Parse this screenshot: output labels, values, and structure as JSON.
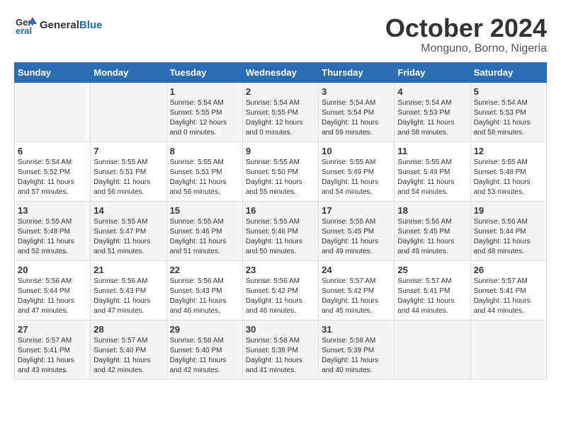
{
  "header": {
    "logo_general": "General",
    "logo_blue": "Blue",
    "title": "October 2024",
    "subtitle": "Monguno, Borno, Nigeria"
  },
  "columns": [
    "Sunday",
    "Monday",
    "Tuesday",
    "Wednesday",
    "Thursday",
    "Friday",
    "Saturday"
  ],
  "weeks": [
    [
      {
        "day": "",
        "info": ""
      },
      {
        "day": "",
        "info": ""
      },
      {
        "day": "1",
        "info": "Sunrise: 5:54 AM\nSunset: 5:55 PM\nDaylight: 12 hours\nand 0 minutes."
      },
      {
        "day": "2",
        "info": "Sunrise: 5:54 AM\nSunset: 5:55 PM\nDaylight: 12 hours\nand 0 minutes."
      },
      {
        "day": "3",
        "info": "Sunrise: 5:54 AM\nSunset: 5:54 PM\nDaylight: 11 hours\nand 59 minutes."
      },
      {
        "day": "4",
        "info": "Sunrise: 5:54 AM\nSunset: 5:53 PM\nDaylight: 11 hours\nand 58 minutes."
      },
      {
        "day": "5",
        "info": "Sunrise: 5:54 AM\nSunset: 5:53 PM\nDaylight: 11 hours\nand 58 minutes."
      }
    ],
    [
      {
        "day": "6",
        "info": "Sunrise: 5:54 AM\nSunset: 5:52 PM\nDaylight: 11 hours\nand 57 minutes."
      },
      {
        "day": "7",
        "info": "Sunrise: 5:55 AM\nSunset: 5:51 PM\nDaylight: 11 hours\nand 56 minutes."
      },
      {
        "day": "8",
        "info": "Sunrise: 5:55 AM\nSunset: 5:51 PM\nDaylight: 11 hours\nand 56 minutes."
      },
      {
        "day": "9",
        "info": "Sunrise: 5:55 AM\nSunset: 5:50 PM\nDaylight: 11 hours\nand 55 minutes."
      },
      {
        "day": "10",
        "info": "Sunrise: 5:55 AM\nSunset: 5:49 PM\nDaylight: 11 hours\nand 54 minutes."
      },
      {
        "day": "11",
        "info": "Sunrise: 5:55 AM\nSunset: 5:49 PM\nDaylight: 11 hours\nand 54 minutes."
      },
      {
        "day": "12",
        "info": "Sunrise: 5:55 AM\nSunset: 5:48 PM\nDaylight: 11 hours\nand 53 minutes."
      }
    ],
    [
      {
        "day": "13",
        "info": "Sunrise: 5:55 AM\nSunset: 5:48 PM\nDaylight: 11 hours\nand 52 minutes."
      },
      {
        "day": "14",
        "info": "Sunrise: 5:55 AM\nSunset: 5:47 PM\nDaylight: 11 hours\nand 51 minutes."
      },
      {
        "day": "15",
        "info": "Sunrise: 5:55 AM\nSunset: 5:46 PM\nDaylight: 11 hours\nand 51 minutes."
      },
      {
        "day": "16",
        "info": "Sunrise: 5:55 AM\nSunset: 5:46 PM\nDaylight: 11 hours\nand 50 minutes."
      },
      {
        "day": "17",
        "info": "Sunrise: 5:55 AM\nSunset: 5:45 PM\nDaylight: 11 hours\nand 49 minutes."
      },
      {
        "day": "18",
        "info": "Sunrise: 5:56 AM\nSunset: 5:45 PM\nDaylight: 11 hours\nand 49 minutes."
      },
      {
        "day": "19",
        "info": "Sunrise: 5:56 AM\nSunset: 5:44 PM\nDaylight: 11 hours\nand 48 minutes."
      }
    ],
    [
      {
        "day": "20",
        "info": "Sunrise: 5:56 AM\nSunset: 5:44 PM\nDaylight: 11 hours\nand 47 minutes."
      },
      {
        "day": "21",
        "info": "Sunrise: 5:56 AM\nSunset: 5:43 PM\nDaylight: 11 hours\nand 47 minutes."
      },
      {
        "day": "22",
        "info": "Sunrise: 5:56 AM\nSunset: 5:43 PM\nDaylight: 11 hours\nand 46 minutes."
      },
      {
        "day": "23",
        "info": "Sunrise: 5:56 AM\nSunset: 5:42 PM\nDaylight: 11 hours\nand 46 minutes."
      },
      {
        "day": "24",
        "info": "Sunrise: 5:57 AM\nSunset: 5:42 PM\nDaylight: 11 hours\nand 45 minutes."
      },
      {
        "day": "25",
        "info": "Sunrise: 5:57 AM\nSunset: 5:41 PM\nDaylight: 11 hours\nand 44 minutes."
      },
      {
        "day": "26",
        "info": "Sunrise: 5:57 AM\nSunset: 5:41 PM\nDaylight: 11 hours\nand 44 minutes."
      }
    ],
    [
      {
        "day": "27",
        "info": "Sunrise: 5:57 AM\nSunset: 5:41 PM\nDaylight: 11 hours\nand 43 minutes."
      },
      {
        "day": "28",
        "info": "Sunrise: 5:57 AM\nSunset: 5:40 PM\nDaylight: 11 hours\nand 42 minutes."
      },
      {
        "day": "29",
        "info": "Sunrise: 5:58 AM\nSunset: 5:40 PM\nDaylight: 11 hours\nand 42 minutes."
      },
      {
        "day": "30",
        "info": "Sunrise: 5:58 AM\nSunset: 5:39 PM\nDaylight: 11 hours\nand 41 minutes."
      },
      {
        "day": "31",
        "info": "Sunrise: 5:58 AM\nSunset: 5:39 PM\nDaylight: 11 hours\nand 40 minutes."
      },
      {
        "day": "",
        "info": ""
      },
      {
        "day": "",
        "info": ""
      }
    ]
  ]
}
